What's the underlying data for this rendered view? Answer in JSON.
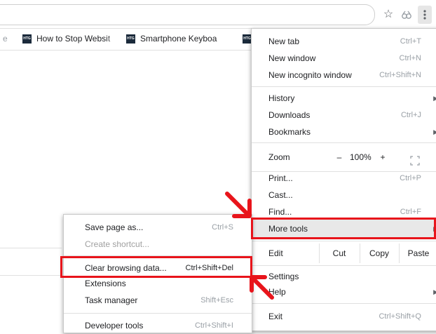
{
  "toolbar": {
    "icons": [
      "star-icon",
      "extension-icon",
      "kebab-menu-icon"
    ]
  },
  "bookmarks": [
    {
      "label": "e",
      "icon": "htg-icon"
    },
    {
      "label": "How to Stop Websit",
      "icon": "htg-icon"
    },
    {
      "label": "Smartphone Keyboa",
      "icon": "htg-icon"
    }
  ],
  "main_menu": {
    "new_tab": {
      "label": "New tab",
      "shortcut": "Ctrl+T"
    },
    "new_window": {
      "label": "New window",
      "shortcut": "Ctrl+N"
    },
    "new_incognito": {
      "label": "New incognito window",
      "shortcut": "Ctrl+Shift+N"
    },
    "history": {
      "label": "History"
    },
    "downloads": {
      "label": "Downloads",
      "shortcut": "Ctrl+J"
    },
    "bookmarks": {
      "label": "Bookmarks"
    },
    "zoom": {
      "label": "Zoom",
      "minus": "–",
      "level": "100%",
      "plus": "+"
    },
    "print": {
      "label": "Print...",
      "shortcut": "Ctrl+P"
    },
    "cast": {
      "label": "Cast..."
    },
    "find": {
      "label": "Find...",
      "shortcut": "Ctrl+F"
    },
    "more_tools": {
      "label": "More tools"
    },
    "edit": {
      "label": "Edit",
      "cut": "Cut",
      "copy": "Copy",
      "paste": "Paste"
    },
    "settings": {
      "label": "Settings"
    },
    "help": {
      "label": "Help"
    },
    "exit": {
      "label": "Exit",
      "shortcut": "Ctrl+Shift+Q"
    }
  },
  "submenu": {
    "save_page": {
      "label": "Save page as...",
      "shortcut": "Ctrl+S"
    },
    "create_shortcut": {
      "label": "Create shortcut..."
    },
    "clear_browsing": {
      "label": "Clear browsing data...",
      "shortcut": "Ctrl+Shift+Del"
    },
    "extensions": {
      "label": "Extensions"
    },
    "task_manager": {
      "label": "Task manager",
      "shortcut": "Shift+Esc"
    },
    "developer_tools": {
      "label": "Developer tools",
      "shortcut": "Ctrl+Shift+I"
    }
  },
  "colors": {
    "highlight": "#e8141b",
    "hover": "#e8e8e8"
  }
}
